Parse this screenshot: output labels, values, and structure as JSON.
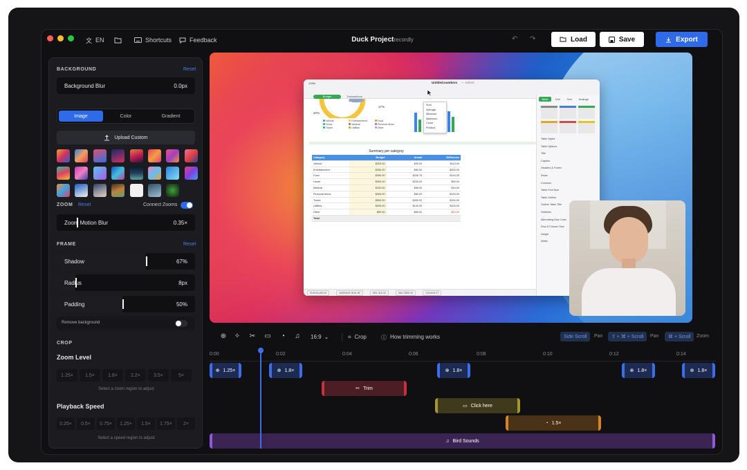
{
  "titlebar": {
    "language": "EN",
    "shortcuts": "Shortcuts",
    "feedback": "Feedback",
    "project_title": "Duck Project",
    "project_suffix": "recordly",
    "load_label": "Load",
    "save_label": "Save",
    "export_label": "Export"
  },
  "panel": {
    "background": {
      "title": "BACKGROUND",
      "reset": "Reset",
      "blur_label": "Background Blur",
      "blur_value": "0.0px",
      "tabs": [
        "Image",
        "Color",
        "Gradient"
      ],
      "upload_label": "Upload Custom"
    },
    "zoom": {
      "title": "ZOOM",
      "reset": "Reset",
      "connect_label": "Connect Zooms",
      "motion_blur_label": "Zoom Motion Blur",
      "motion_blur_value": "0.35×"
    },
    "frame": {
      "title": "FRAME",
      "reset": "Reset",
      "shadow_label": "Shadow",
      "shadow_value": "67%",
      "radius_label": "Radius",
      "radius_value": "8px",
      "padding_label": "Padding",
      "padding_value": "50%",
      "remove_bg_label": "Remove background"
    },
    "crop": {
      "title": "CROP"
    },
    "zoom_level": {
      "title": "Zoom Level",
      "options": [
        "1.25×",
        "1.5×",
        "1.8×",
        "2.2×",
        "3.5×",
        "5×"
      ],
      "hint": "Select a zoom region to adjust"
    },
    "playback_speed": {
      "title": "Playback Speed",
      "options": [
        "0.25×",
        "0.5×",
        "0.75×",
        "1.25×",
        "1.5×",
        "1.75×",
        "2×"
      ],
      "hint": "Select a speed region to adjust"
    }
  },
  "preview": {
    "screenshot": {
      "file_name": "Untitled.numbers",
      "edited": "— Edited",
      "zoom": "125%",
      "tab_budget": "Budget",
      "tab_transactions": "Transactions",
      "sheet_title": "Summary per category",
      "headers": [
        "Category",
        "Budget",
        "Actual",
        "Difference"
      ],
      "rows": [
        [
          "Vehicle",
          "$200.00",
          "$90.00",
          "$110.00"
        ],
        [
          "Entertainment",
          "$250.00",
          "$50.00",
          "$200.00"
        ],
        [
          "Food",
          "$350.00",
          "$205.75",
          "$144.25"
        ],
        [
          "Home",
          "$300.00",
          "$250.00",
          "$50.00"
        ],
        [
          "Medical",
          "$100.00",
          "$56.00",
          "$44.00"
        ],
        [
          "Personal Items",
          "$300.00",
          "$80.00",
          "$220.00"
        ],
        [
          "Travel",
          "$500.00",
          "$350.00",
          "$150.00"
        ],
        [
          "Utilities",
          "$200.00",
          "$100.00",
          "$100.00"
        ],
        [
          "Other",
          "$50.00",
          "$60.00",
          "-$10.00"
        ],
        [
          "Total",
          "",
          "",
          ""
        ]
      ],
      "percent_a": "20%",
      "percent_b": "17%",
      "legend": [
        "Vehicle",
        "Entertainment",
        "Food",
        "Home",
        "Medical",
        "Personal Items",
        "Travel",
        "Utilities",
        "Other"
      ],
      "menu": [
        "Sum",
        "Average",
        "Minimum",
        "Maximum",
        "Count",
        "Product"
      ],
      "sidebar_tabs": [
        "Table",
        "Cell",
        "Text",
        "Arrange"
      ],
      "sidebar_labels": [
        "Table Styles",
        "Table Options",
        "Title",
        "Caption",
        "Headers & Footer",
        "Rows",
        "Columns",
        "Table Font Size",
        "Table Outline",
        "Outline Table Title",
        "Gridlines",
        "Alternating Row Color",
        "Row & Column Size",
        "Height",
        "Width"
      ],
      "status": [
        "SUM $4,450.00",
        "AVERAGE $161.80",
        "MIN -$10.00",
        "MAX $350.00",
        "COUNTA 27"
      ]
    }
  },
  "timeline": {
    "aspect": "16:9",
    "crop": "Crop",
    "how_trimming": "How trimming works",
    "shortcut1_key": "Side Scroll",
    "shortcut1_label": "Pan",
    "shortcut2_key": "⇧ + ⌘ + Scroll",
    "shortcut2_label": "Pan",
    "shortcut3_key": "⌘ + Scroll",
    "shortcut3_label": "Zoom",
    "ticks": [
      "0:00",
      "0:02",
      "0:04",
      "0:06",
      "0:08",
      "0:10",
      "0:12",
      "0:14"
    ],
    "zoom_clips": [
      "1.25×",
      "1.8×",
      "1.8×",
      "1.8×",
      "1.8×"
    ],
    "trim_label": "Trim",
    "annotation_label": "Click here",
    "speed_label": "1.5×",
    "audio_label": "Bird Sounds"
  },
  "colors": {
    "accent": "#3f6fe6",
    "export_button": "#2f6ae8",
    "trim": "#b8323a",
    "annotation": "#8a7a25",
    "speed": "#c87a1e",
    "audio": "#6b3ea8"
  }
}
